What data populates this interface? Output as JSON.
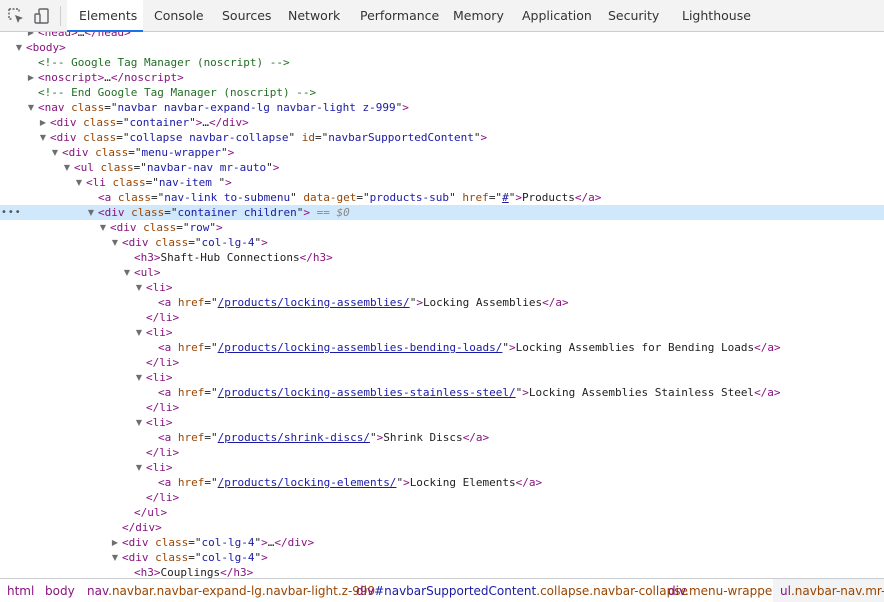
{
  "toolbar": {
    "tabs": [
      {
        "label": "Elements",
        "active": true
      },
      {
        "label": "Console"
      },
      {
        "label": "Sources"
      },
      {
        "label": "Network"
      },
      {
        "label": "Performance"
      },
      {
        "label": "Memory"
      },
      {
        "label": "Application"
      },
      {
        "label": "Security"
      },
      {
        "label": "Lighthouse"
      }
    ],
    "accent_color": "#1a73e8",
    "inspect_icon": "inspect-element-icon",
    "device_icon": "device-toolbar-icon"
  },
  "tree": {
    "selected_marker": "== $0",
    "ellipsis": "•••",
    "rows": [
      {
        "depth": 1,
        "toggle": "collapsed",
        "parts": [
          [
            "tg",
            "<head>"
          ],
          [
            "tx",
            "…"
          ],
          [
            "tg",
            "</head>"
          ]
        ]
      },
      {
        "depth": 0,
        "toggle": "expanded",
        "parts": [
          [
            "tg",
            "<body>"
          ]
        ]
      },
      {
        "depth": 1,
        "toggle": "none",
        "parts": [
          [
            "cm",
            "<!-- Google Tag Manager (noscript) -->"
          ]
        ]
      },
      {
        "depth": 1,
        "toggle": "collapsed",
        "parts": [
          [
            "tg",
            "<noscript>"
          ],
          [
            "tx",
            "…"
          ],
          [
            "tg",
            "</noscript>"
          ]
        ]
      },
      {
        "depth": 1,
        "toggle": "none",
        "parts": [
          [
            "cm",
            "<!-- End Google Tag Manager (noscript) -->"
          ]
        ]
      },
      {
        "depth": 1,
        "toggle": "expanded",
        "parts": [
          [
            "tg",
            "<nav "
          ],
          [
            "an",
            "class"
          ],
          [
            "eq",
            "=\""
          ],
          [
            "av",
            "navbar navbar-expand-lg navbar-light z-999"
          ],
          [
            "eq",
            "\""
          ],
          [
            "tg",
            ">"
          ]
        ]
      },
      {
        "depth": 2,
        "toggle": "collapsed",
        "parts": [
          [
            "tg",
            "<div "
          ],
          [
            "an",
            "class"
          ],
          [
            "eq",
            "=\""
          ],
          [
            "av",
            "container"
          ],
          [
            "eq",
            "\""
          ],
          [
            "tg",
            ">"
          ],
          [
            "tx",
            "…"
          ],
          [
            "tg",
            "</div>"
          ]
        ]
      },
      {
        "depth": 2,
        "toggle": "expanded",
        "parts": [
          [
            "tg",
            "<div "
          ],
          [
            "an",
            "class"
          ],
          [
            "eq",
            "=\""
          ],
          [
            "av",
            "collapse navbar-collapse"
          ],
          [
            "eq",
            "\" "
          ],
          [
            "an",
            "id"
          ],
          [
            "eq",
            "=\""
          ],
          [
            "av",
            "navbarSupportedContent"
          ],
          [
            "eq",
            "\""
          ],
          [
            "tg",
            ">"
          ]
        ]
      },
      {
        "depth": 3,
        "toggle": "expanded",
        "parts": [
          [
            "tg",
            "<div "
          ],
          [
            "an",
            "class"
          ],
          [
            "eq",
            "=\""
          ],
          [
            "av",
            "menu-wrapper"
          ],
          [
            "eq",
            "\""
          ],
          [
            "tg",
            ">"
          ]
        ]
      },
      {
        "depth": 4,
        "toggle": "expanded",
        "parts": [
          [
            "tg",
            "<ul "
          ],
          [
            "an",
            "class"
          ],
          [
            "eq",
            "=\""
          ],
          [
            "av",
            "navbar-nav mr-auto"
          ],
          [
            "eq",
            "\""
          ],
          [
            "tg",
            ">"
          ]
        ]
      },
      {
        "depth": 5,
        "toggle": "expanded",
        "parts": [
          [
            "tg",
            "<li "
          ],
          [
            "an",
            "class"
          ],
          [
            "eq",
            "=\""
          ],
          [
            "av",
            "nav-item "
          ],
          [
            "eq",
            "\""
          ],
          [
            "tg",
            ">"
          ]
        ]
      },
      {
        "depth": 6,
        "toggle": "none",
        "parts": [
          [
            "tg",
            "<a "
          ],
          [
            "an",
            "class"
          ],
          [
            "eq",
            "=\""
          ],
          [
            "av",
            "nav-link to-submenu"
          ],
          [
            "eq",
            "\" "
          ],
          [
            "an",
            "data-get"
          ],
          [
            "eq",
            "=\""
          ],
          [
            "av",
            "products-sub"
          ],
          [
            "eq",
            "\" "
          ],
          [
            "an",
            "href"
          ],
          [
            "eq",
            "=\""
          ],
          [
            "lnk",
            "#"
          ],
          [
            "eq",
            "\""
          ],
          [
            "tg",
            ">"
          ],
          [
            "tx",
            "Products"
          ],
          [
            "tg",
            "</a>"
          ]
        ]
      },
      {
        "depth": 6,
        "toggle": "expanded",
        "selected": true,
        "parts": [
          [
            "tg",
            "<div "
          ],
          [
            "an",
            "class"
          ],
          [
            "eq",
            "=\""
          ],
          [
            "av",
            "container children"
          ],
          [
            "eq",
            "\""
          ],
          [
            "tg",
            ">"
          ]
        ]
      },
      {
        "depth": 7,
        "toggle": "expanded",
        "parts": [
          [
            "tg",
            "<div "
          ],
          [
            "an",
            "class"
          ],
          [
            "eq",
            "=\""
          ],
          [
            "av",
            "row"
          ],
          [
            "eq",
            "\""
          ],
          [
            "tg",
            ">"
          ]
        ]
      },
      {
        "depth": 8,
        "toggle": "expanded",
        "parts": [
          [
            "tg",
            "<div "
          ],
          [
            "an",
            "class"
          ],
          [
            "eq",
            "=\""
          ],
          [
            "av",
            "col-lg-4"
          ],
          [
            "eq",
            "\""
          ],
          [
            "tg",
            ">"
          ]
        ]
      },
      {
        "depth": 9,
        "toggle": "none",
        "parts": [
          [
            "tg",
            "<h3>"
          ],
          [
            "tx",
            "Shaft-Hub Connections"
          ],
          [
            "tg",
            "</h3>"
          ]
        ]
      },
      {
        "depth": 9,
        "toggle": "expanded",
        "parts": [
          [
            "tg",
            "<ul>"
          ]
        ]
      },
      {
        "depth": 10,
        "toggle": "expanded",
        "parts": [
          [
            "tg",
            "<li>"
          ]
        ]
      },
      {
        "depth": 11,
        "toggle": "none",
        "parts": [
          [
            "tg",
            "<a "
          ],
          [
            "an",
            "href"
          ],
          [
            "eq",
            "=\""
          ],
          [
            "lnk",
            "/products/locking-assemblies/"
          ],
          [
            "eq",
            "\""
          ],
          [
            "tg",
            ">"
          ],
          [
            "tx",
            "Locking Assemblies"
          ],
          [
            "tg",
            "</a>"
          ]
        ]
      },
      {
        "depth": 10,
        "toggle": "none",
        "parts": [
          [
            "tg",
            "</li>"
          ]
        ]
      },
      {
        "depth": 10,
        "toggle": "expanded",
        "parts": [
          [
            "tg",
            "<li>"
          ]
        ]
      },
      {
        "depth": 11,
        "toggle": "none",
        "parts": [
          [
            "tg",
            "<a "
          ],
          [
            "an",
            "href"
          ],
          [
            "eq",
            "=\""
          ],
          [
            "lnk",
            "/products/locking-assemblies-bending-loads/"
          ],
          [
            "eq",
            "\""
          ],
          [
            "tg",
            ">"
          ],
          [
            "tx",
            "Locking Assemblies for Bending Loads"
          ],
          [
            "tg",
            "</a>"
          ]
        ]
      },
      {
        "depth": 10,
        "toggle": "none",
        "parts": [
          [
            "tg",
            "</li>"
          ]
        ]
      },
      {
        "depth": 10,
        "toggle": "expanded",
        "parts": [
          [
            "tg",
            "<li>"
          ]
        ]
      },
      {
        "depth": 11,
        "toggle": "none",
        "parts": [
          [
            "tg",
            "<a "
          ],
          [
            "an",
            "href"
          ],
          [
            "eq",
            "=\""
          ],
          [
            "lnk",
            "/products/locking-assemblies-stainless-steel/"
          ],
          [
            "eq",
            "\""
          ],
          [
            "tg",
            ">"
          ],
          [
            "tx",
            "Locking Assemblies Stainless Steel"
          ],
          [
            "tg",
            "</a>"
          ]
        ]
      },
      {
        "depth": 10,
        "toggle": "none",
        "parts": [
          [
            "tg",
            "</li>"
          ]
        ]
      },
      {
        "depth": 10,
        "toggle": "expanded",
        "parts": [
          [
            "tg",
            "<li>"
          ]
        ]
      },
      {
        "depth": 11,
        "toggle": "none",
        "parts": [
          [
            "tg",
            "<a "
          ],
          [
            "an",
            "href"
          ],
          [
            "eq",
            "=\""
          ],
          [
            "lnk",
            "/products/shrink-discs/"
          ],
          [
            "eq",
            "\""
          ],
          [
            "tg",
            ">"
          ],
          [
            "tx",
            "Shrink Discs"
          ],
          [
            "tg",
            "</a>"
          ]
        ]
      },
      {
        "depth": 10,
        "toggle": "none",
        "parts": [
          [
            "tg",
            "</li>"
          ]
        ]
      },
      {
        "depth": 10,
        "toggle": "expanded",
        "parts": [
          [
            "tg",
            "<li>"
          ]
        ]
      },
      {
        "depth": 11,
        "toggle": "none",
        "parts": [
          [
            "tg",
            "<a "
          ],
          [
            "an",
            "href"
          ],
          [
            "eq",
            "=\""
          ],
          [
            "lnk",
            "/products/locking-elements/"
          ],
          [
            "eq",
            "\""
          ],
          [
            "tg",
            ">"
          ],
          [
            "tx",
            "Locking Elements"
          ],
          [
            "tg",
            "</a>"
          ]
        ]
      },
      {
        "depth": 10,
        "toggle": "none",
        "parts": [
          [
            "tg",
            "</li>"
          ]
        ]
      },
      {
        "depth": 9,
        "toggle": "none",
        "parts": [
          [
            "tg",
            "</ul>"
          ]
        ]
      },
      {
        "depth": 8,
        "toggle": "none",
        "parts": [
          [
            "tg",
            "</div>"
          ]
        ]
      },
      {
        "depth": 8,
        "toggle": "collapsed",
        "parts": [
          [
            "tg",
            "<div "
          ],
          [
            "an",
            "class"
          ],
          [
            "eq",
            "=\""
          ],
          [
            "av",
            "col-lg-4"
          ],
          [
            "eq",
            "\""
          ],
          [
            "tg",
            ">"
          ],
          [
            "tx",
            "…"
          ],
          [
            "tg",
            "</div>"
          ]
        ]
      },
      {
        "depth": 8,
        "toggle": "expanded",
        "parts": [
          [
            "tg",
            "<div "
          ],
          [
            "an",
            "class"
          ],
          [
            "eq",
            "=\""
          ],
          [
            "av",
            "col-lg-4"
          ],
          [
            "eq",
            "\""
          ],
          [
            "tg",
            ">"
          ]
        ]
      },
      {
        "depth": 9,
        "toggle": "none",
        "parts": [
          [
            "tg",
            "<h3>"
          ],
          [
            "tx",
            "Couplings"
          ],
          [
            "tg",
            "</h3>"
          ]
        ]
      }
    ]
  },
  "breadcrumb": {
    "items": [
      {
        "tag": "html",
        "id": "",
        "cls": ""
      },
      {
        "tag": "body",
        "id": "",
        "cls": ""
      },
      {
        "tag": "nav",
        "id": "",
        "cls": ".navbar.navbar-expand-lg.navbar-light.z-999"
      },
      {
        "tag": "div",
        "id": "#navbarSupportedContent",
        "cls": ".collapse.navbar-collapse"
      },
      {
        "tag": "div",
        "id": "",
        "cls": ".menu-wrapper"
      },
      {
        "tag": "ul",
        "id": "",
        "cls": ".navbar-nav.mr-auto",
        "selected": true
      }
    ]
  }
}
